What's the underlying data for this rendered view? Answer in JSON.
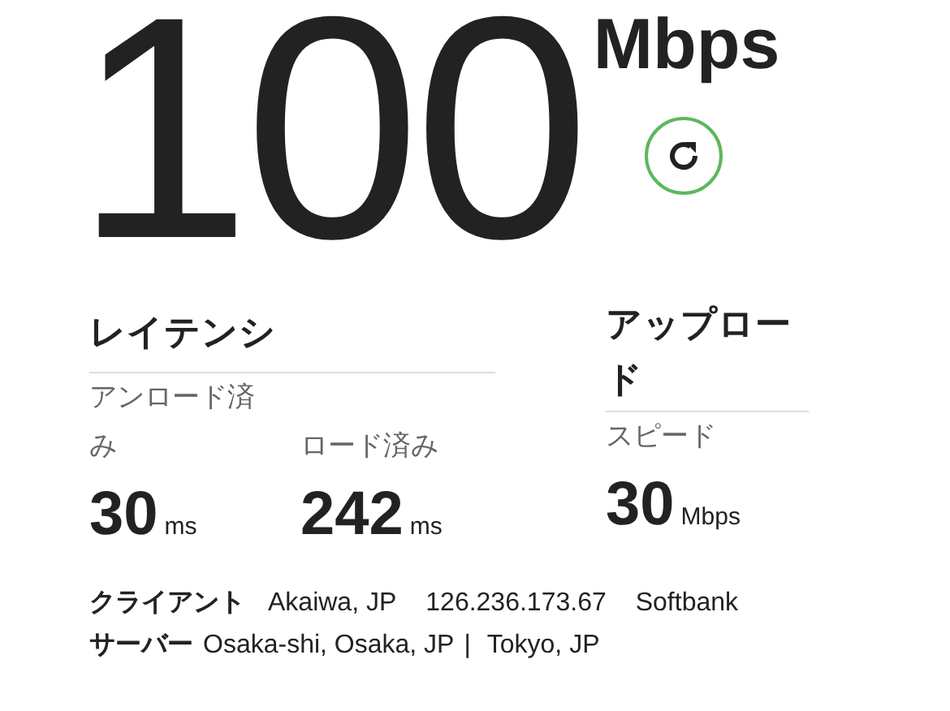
{
  "speed": {
    "value": "100",
    "unit": "Mbps"
  },
  "latency": {
    "title": "レイテンシ",
    "metrics": [
      {
        "label": "アンロード済み",
        "value": "30",
        "unit": "ms"
      },
      {
        "label": "ロード済み",
        "value": "242",
        "unit": "ms"
      }
    ]
  },
  "upload": {
    "title": "アップロード",
    "metrics": [
      {
        "label": "スピード",
        "value": "30",
        "unit": "Mbps"
      }
    ]
  },
  "client": {
    "label": "クライアント",
    "values": [
      "Akaiwa, JP",
      "126.236.173.67",
      "Softbank"
    ]
  },
  "server": {
    "label": "サーバー",
    "values": [
      "Osaka-shi, Osaka, JP",
      "Tokyo, JP"
    ],
    "separator": "|"
  }
}
